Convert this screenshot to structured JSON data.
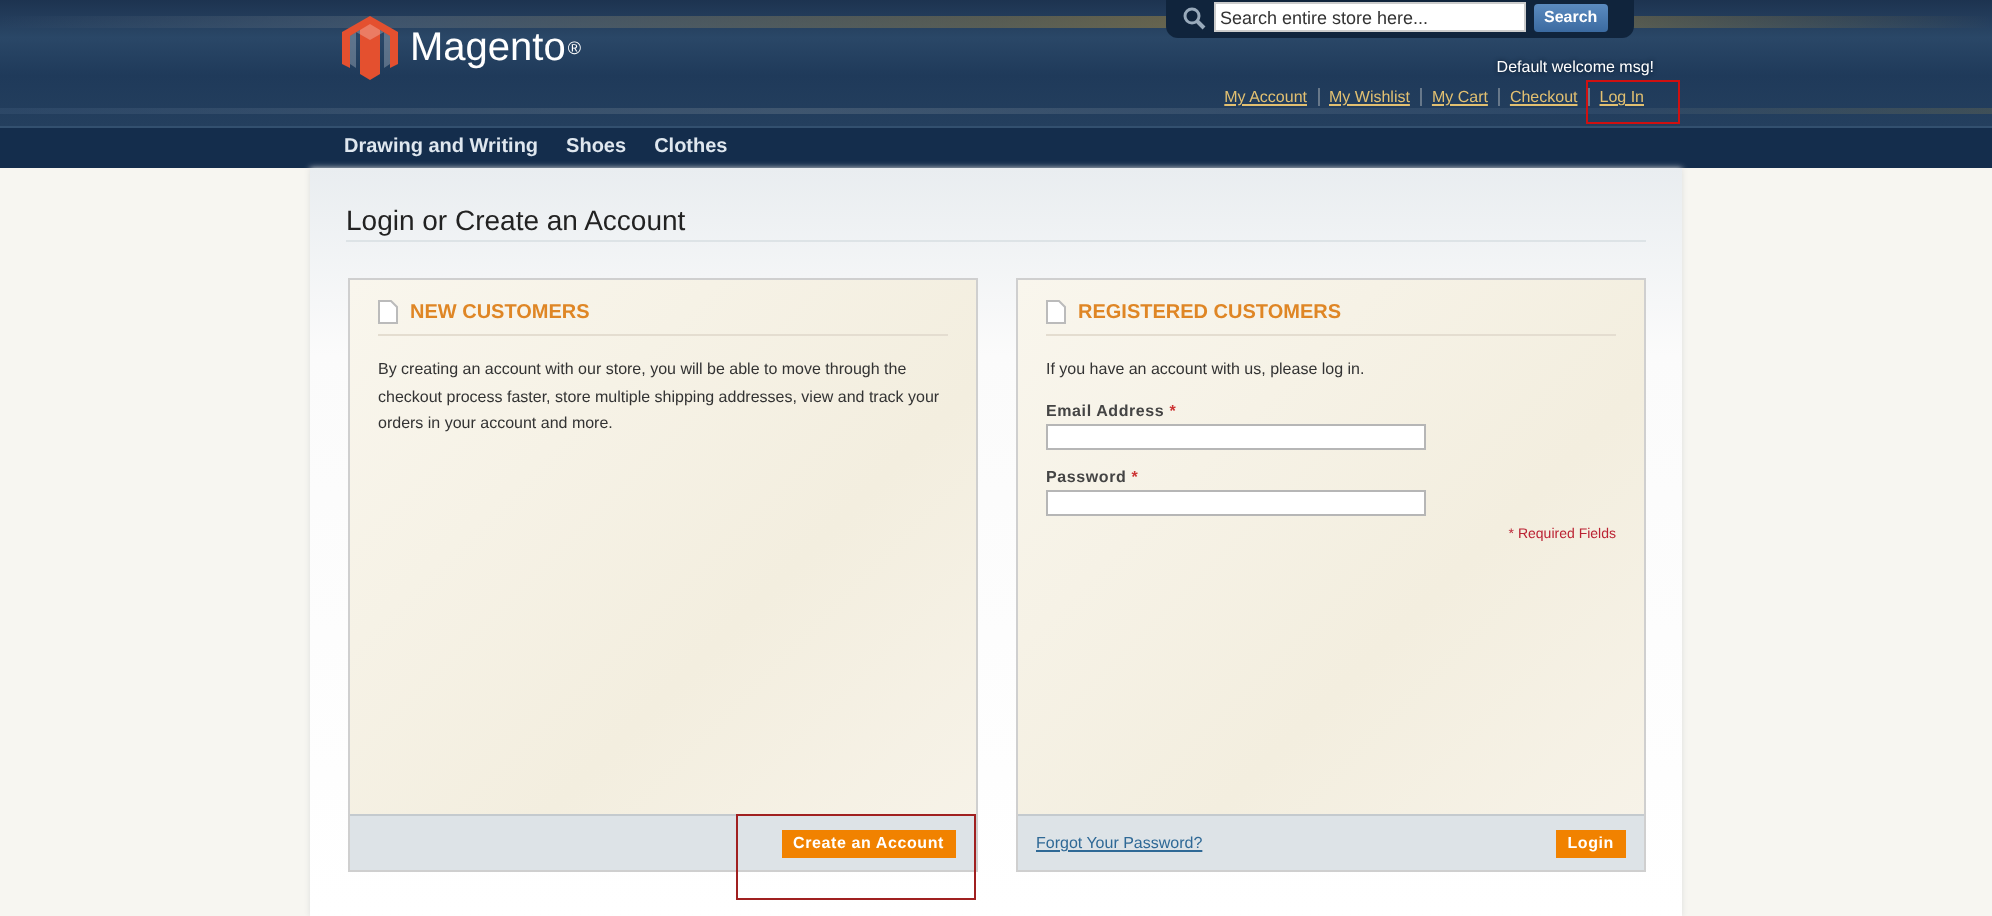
{
  "header": {
    "logo": "Magento",
    "logo_mark": "®",
    "search": {
      "placeholder": "Search entire store here...",
      "button": "Search"
    },
    "welcome": "Default welcome msg!",
    "links": [
      {
        "label": "My Account",
        "highlighted": false
      },
      {
        "label": "My Wishlist",
        "highlighted": false
      },
      {
        "label": "My Cart",
        "highlighted": false
      },
      {
        "label": "Checkout",
        "highlighted": false
      },
      {
        "label": "Log In",
        "highlighted": true
      }
    ]
  },
  "nav": [
    "Drawing and Writing",
    "Shoes",
    "Clothes"
  ],
  "page_title": "Login or Create an Account",
  "panels": [
    {
      "kind": "new",
      "title": "NEW CUSTOMERS",
      "text": "By creating an account with our store, you will be able to move through the checkout process faster, store multiple shipping addresses, view and track your orders in your account and more.",
      "button": "Create an Account",
      "button_highlighted": true
    },
    {
      "kind": "login",
      "title": "REGISTERED CUSTOMERS",
      "text": "If you have an account with us, please log in.",
      "fields": [
        {
          "label": "Email Address",
          "required": "*"
        },
        {
          "label": "Password",
          "required": "*"
        }
      ],
      "required_note": "* Required Fields",
      "link": "Forgot Your Password?",
      "button": "Login",
      "button_highlighted": false
    }
  ]
}
